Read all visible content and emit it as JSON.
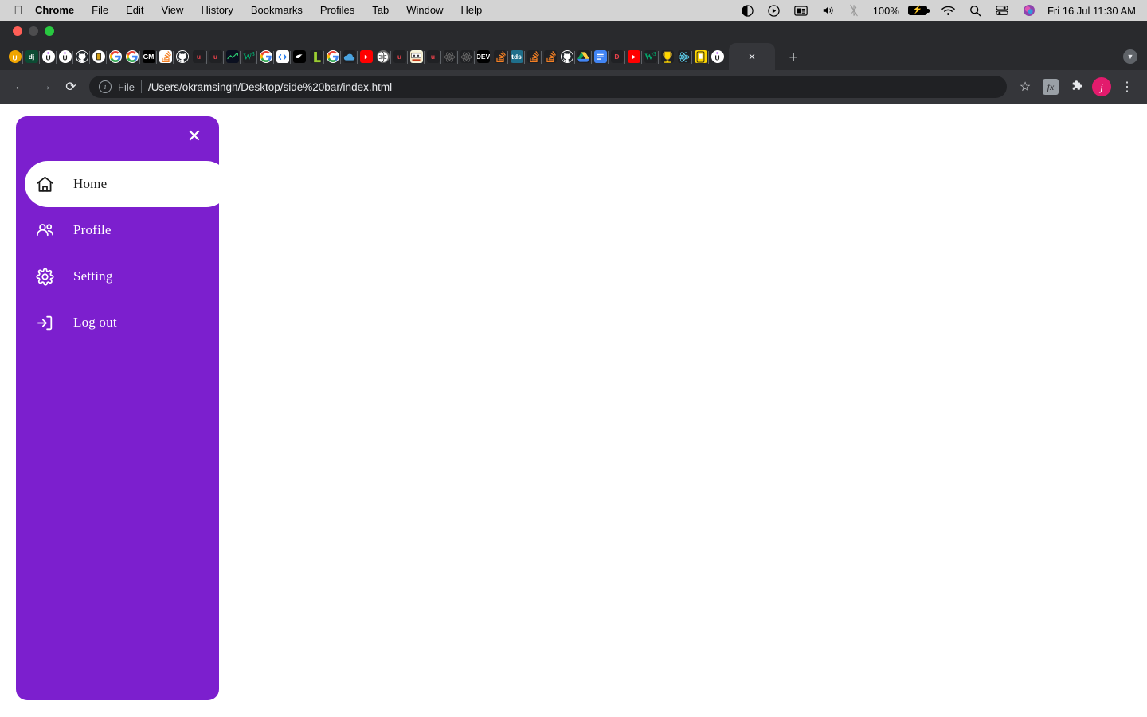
{
  "menubar": {
    "apple_icon": "apple-logo",
    "items": [
      "Chrome",
      "File",
      "Edit",
      "View",
      "History",
      "Bookmarks",
      "Profiles",
      "Tab",
      "Window",
      "Help"
    ],
    "status": {
      "battery_percent": "100%",
      "datetime": "Fri 16 Jul  11:30 AM",
      "icons": [
        "contrast-icon",
        "screen-record-icon",
        "keyboard-viewer-icon",
        "volume-icon",
        "bluetooth-off-icon",
        "battery-icon",
        "wifi-icon",
        "spotlight-search-icon",
        "control-center-icon",
        "siri-icon"
      ]
    }
  },
  "browser": {
    "traffic_lights": [
      "close",
      "minimize",
      "zoom"
    ],
    "tabs": [
      {
        "name": "udemy",
        "glyph": "U",
        "bg": "#f0a500",
        "fg": "#ffffff",
        "shape": "circle"
      },
      {
        "name": "django",
        "glyph": "dj",
        "bg": "#0c4b33",
        "fg": "#ffffff",
        "shape": "square"
      },
      {
        "name": "unacademy",
        "glyph": "U",
        "bg": "#ffffff",
        "fg": "#1a1a1a",
        "shape": "circle"
      },
      {
        "name": "unacademy-2",
        "glyph": "U",
        "bg": "#ffffff",
        "fg": "#1a1a1a",
        "shape": "circle"
      },
      {
        "name": "github",
        "glyph": "github-mark",
        "bg": "#ffffff",
        "fg": "#24292e",
        "shape": "circle"
      },
      {
        "name": "beer-app",
        "glyph": "B",
        "bg": "#ffffff",
        "fg": "#d4a017",
        "shape": "circle"
      },
      {
        "name": "google",
        "glyph": "google-g",
        "bg": "#ffffff",
        "fg": "#4285f4",
        "shape": "circle"
      },
      {
        "name": "google-2",
        "glyph": "google-g",
        "bg": "#ffffff",
        "fg": "#4285f4",
        "shape": "circle"
      },
      {
        "name": "gm-black",
        "glyph": "GM",
        "bg": "#000000",
        "fg": "#ffffff",
        "shape": "square"
      },
      {
        "name": "stackoverflow",
        "glyph": "so-stack",
        "bg": "#ffffff",
        "fg": "#f48024",
        "shape": "square"
      },
      {
        "name": "github-2",
        "glyph": "github-mark",
        "bg": "#ffffff",
        "fg": "#24292e",
        "shape": "circle"
      },
      {
        "name": "udacity-u",
        "glyph": "u",
        "bg": "#202124",
        "fg": "#e8414a",
        "shape": "square"
      },
      {
        "name": "udacity-u-2",
        "glyph": "u",
        "bg": "#202124",
        "fg": "#e8414a",
        "shape": "square"
      },
      {
        "name": "techie-dark",
        "glyph": "tech",
        "bg": "#0b1020",
        "fg": "#2ecc71",
        "shape": "square"
      },
      {
        "name": "w3schools",
        "glyph": "w3",
        "bg": "#202124",
        "fg": "#04aa6d",
        "shape": "square"
      },
      {
        "name": "google-3",
        "glyph": "google-g",
        "bg": "#ffffff",
        "fg": "#4285f4",
        "shape": "circle"
      },
      {
        "name": "codepen-blue",
        "glyph": "code",
        "bg": "#ffffff",
        "fg": "#1a73e8",
        "shape": "square"
      },
      {
        "name": "black-bird",
        "glyph": "bird",
        "bg": "#000000",
        "fg": "#ffffff",
        "shape": "square"
      },
      {
        "name": "leetcode-green",
        "glyph": "L",
        "bg": "#202124",
        "fg": "#9acd32",
        "shape": "square"
      },
      {
        "name": "google-4",
        "glyph": "google-g",
        "bg": "#ffffff",
        "fg": "#4285f4",
        "shape": "circle"
      },
      {
        "name": "cloud-blue",
        "glyph": "cloud",
        "bg": "#202124",
        "fg": "#4aa3df",
        "shape": "square"
      },
      {
        "name": "youtube",
        "glyph": "yt",
        "bg": "#ff0000",
        "fg": "#ffffff",
        "shape": "square"
      },
      {
        "name": "globe-gray",
        "glyph": "globe",
        "bg": "#6b6b6b",
        "fg": "#ffffff",
        "shape": "circle"
      },
      {
        "name": "udacity-u-3",
        "glyph": "u",
        "bg": "#202124",
        "fg": "#e8414a",
        "shape": "square"
      },
      {
        "name": "pixel-art",
        "glyph": "pix",
        "bg": "#f5f5dc",
        "fg": "#c23616",
        "shape": "square"
      },
      {
        "name": "udacity-u-4",
        "glyph": "u",
        "bg": "#202124",
        "fg": "#e8414a",
        "shape": "square"
      },
      {
        "name": "react-atom",
        "glyph": "react",
        "bg": "#202124",
        "fg": "#6b6b6b",
        "shape": "square"
      },
      {
        "name": "react-atom-2",
        "glyph": "react",
        "bg": "#202124",
        "fg": "#6b6b6b",
        "shape": "square"
      },
      {
        "name": "dev-to",
        "glyph": "DEV",
        "bg": "#000000",
        "fg": "#ffffff",
        "shape": "square"
      },
      {
        "name": "stackoverflow-2",
        "glyph": "so-stack",
        "bg": "#202124",
        "fg": "#f48024",
        "shape": "square"
      },
      {
        "name": "towards-data-science",
        "glyph": "tds",
        "bg": "#1f6f8b",
        "fg": "#ffffff",
        "shape": "square"
      },
      {
        "name": "stackoverflow-3",
        "glyph": "so-stack",
        "bg": "#202124",
        "fg": "#f48024",
        "shape": "square"
      },
      {
        "name": "stackoverflow-4",
        "glyph": "so-stack",
        "bg": "#202124",
        "fg": "#f48024",
        "shape": "square"
      },
      {
        "name": "github-3",
        "glyph": "github-mark",
        "bg": "#ffffff",
        "fg": "#24292e",
        "shape": "circle"
      },
      {
        "name": "google-drive",
        "glyph": "drive",
        "bg": "#202124",
        "fg": "#0f9d58",
        "shape": "square"
      },
      {
        "name": "google-docs",
        "glyph": "docs",
        "bg": "#4285f4",
        "fg": "#ffffff",
        "shape": "square"
      },
      {
        "name": "dribbble-red",
        "glyph": "D",
        "bg": "#202124",
        "fg": "#e8414a",
        "shape": "square"
      },
      {
        "name": "youtube-2",
        "glyph": "yt",
        "bg": "#ff0000",
        "fg": "#ffffff",
        "shape": "square"
      },
      {
        "name": "w3schools-2",
        "glyph": "w3",
        "bg": "#202124",
        "fg": "#04aa6d",
        "shape": "square"
      },
      {
        "name": "trophy-cup",
        "glyph": "cup",
        "bg": "#202124",
        "fg": "#ffd700",
        "shape": "square"
      },
      {
        "name": "react-atom-3",
        "glyph": "react",
        "bg": "#202124",
        "fg": "#61dafb",
        "shape": "square"
      },
      {
        "name": "yellow-cup",
        "glyph": "cup2",
        "bg": "#ffd700",
        "fg": "#1a1a1a",
        "shape": "square"
      },
      {
        "name": "unacademy-3",
        "glyph": "U",
        "bg": "#ffffff",
        "fg": "#1a1a1a",
        "shape": "circle"
      }
    ],
    "active_tab": {
      "close_label": "×"
    },
    "new_tab_label": "+",
    "tab_search_icon": "chevron-down-icon",
    "toolbar": {
      "back_icon": "←",
      "forward_icon": "→",
      "reload_icon": "⟳",
      "security_label": "File",
      "url": "/Users/okramsingh/Desktop/side%20bar/index.html",
      "bookmark_icon": "☆",
      "extension_badge": "fx",
      "puzzle_icon": "puzzle-piece-icon",
      "profile_initial": "j",
      "menu_icon": "⋮"
    }
  },
  "sidebar": {
    "close_label": "✕",
    "background_color": "#7c1fce",
    "active_item_color": "#ffffff",
    "items": [
      {
        "label": "Home",
        "icon": "home-icon",
        "active": true
      },
      {
        "label": "Profile",
        "icon": "users-icon",
        "active": false
      },
      {
        "label": "Setting",
        "icon": "gear-icon",
        "active": false
      },
      {
        "label": "Log out",
        "icon": "logout-icon",
        "active": false
      }
    ]
  }
}
